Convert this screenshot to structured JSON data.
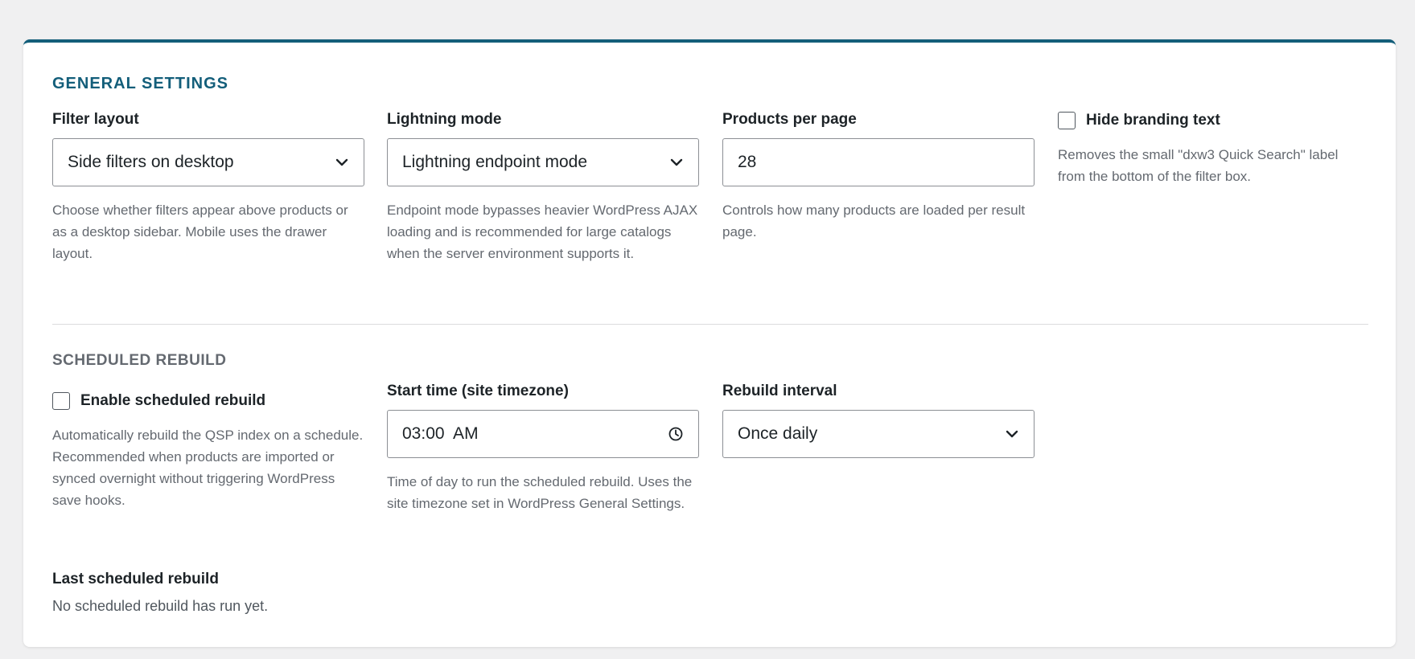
{
  "general": {
    "title": "GENERAL SETTINGS",
    "filter_layout": {
      "label": "Filter layout",
      "value": "Side filters on desktop",
      "help": "Choose whether filters appear above products or as a desktop sidebar. Mobile uses the drawer layout."
    },
    "lightning_mode": {
      "label": "Lightning mode",
      "value": "Lightning endpoint mode",
      "help": "Endpoint mode bypasses heavier WordPress AJAX loading and is recommended for large catalogs when the server environment supports it."
    },
    "products_per_page": {
      "label": "Products per page",
      "value": "28",
      "help": "Controls how many products are loaded per result page."
    },
    "hide_branding": {
      "label": "Hide branding text",
      "checked": false,
      "help": "Removes the small \"dxw3 Quick Search\" label from the bottom of the filter box."
    }
  },
  "scheduled": {
    "title": "SCHEDULED REBUILD",
    "enable": {
      "label": "Enable scheduled rebuild",
      "checked": false,
      "help": "Automatically rebuild the QSP index on a schedule. Recommended when products are imported or synced overnight without triggering WordPress save hooks."
    },
    "start_time": {
      "label": "Start time (site timezone)",
      "value": "03:00  AM",
      "help": "Time of day to run the scheduled rebuild. Uses the site timezone set in WordPress General Settings."
    },
    "interval": {
      "label": "Rebuild interval",
      "value": "Once daily"
    },
    "last": {
      "label": "Last scheduled rebuild",
      "value": "No scheduled rebuild has run yet."
    }
  },
  "colors": {
    "accent": "#135e7a",
    "muted": "#646970",
    "border": "#8c8f94"
  }
}
